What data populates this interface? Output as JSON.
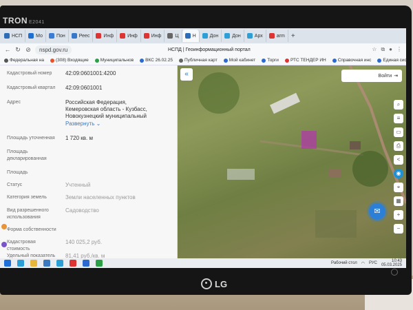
{
  "monitor": {
    "brand": "TRON",
    "model": "E2041",
    "logo": "LG"
  },
  "browser": {
    "tabs": [
      {
        "label": "НСП",
        "color": "#2d6db8"
      },
      {
        "label": "Мо",
        "color": "#1f6fd1"
      },
      {
        "label": "Пон",
        "color": "#3a7bd5"
      },
      {
        "label": "Реес",
        "color": "#3577c9"
      },
      {
        "label": "Инф",
        "color": "#d33"
      },
      {
        "label": "Инф",
        "color": "#d33"
      },
      {
        "label": "Инф",
        "color": "#d33"
      },
      {
        "label": "Ц",
        "color": "#666"
      },
      {
        "label": "Н",
        "color": "#2d6db8"
      },
      {
        "label": "Дон",
        "color": "#2b9fd6"
      },
      {
        "label": "Дон",
        "color": "#2b9fd6"
      },
      {
        "label": "Арх",
        "color": "#2b9fd6"
      },
      {
        "label": "arm",
        "color": "#d33"
      }
    ],
    "new_tab": "+",
    "url": "nspd.gov.ru",
    "page_title": "НСПД | Геоинформационный портал",
    "bookmarks": [
      {
        "label": "Федеральная на",
        "color": "#555"
      },
      {
        "label": "(308) Входящие",
        "color": "#e6522c"
      },
      {
        "label": "Муниципальнов",
        "color": "#2b9f45"
      },
      {
        "label": "ВКС 26.02.25",
        "color": "#2b6bd1"
      },
      {
        "label": "Публичная карт",
        "color": "#666"
      },
      {
        "label": "Мой кабинет",
        "color": "#2b6bd1"
      },
      {
        "label": "Торги",
        "color": "#2b6bd1"
      },
      {
        "label": "РТС ТЕНДЕР ИН",
        "color": "#d33"
      },
      {
        "label": "Справочная инс",
        "color": "#2b6bd1"
      },
      {
        "label": "Единая сист",
        "color": "#2b6bd1"
      }
    ]
  },
  "panel": {
    "rows": [
      {
        "label": "Кадастровый номер",
        "value": "42:09:0601001:4200"
      },
      {
        "label": "Кадастровый квартал",
        "value": "42:09:0601001"
      }
    ],
    "address": {
      "label": "Адрес",
      "lines": [
        "Российская Федерация,",
        "Кемеровская область - Кузбасс,",
        "Новокузнецкий муниципальный"
      ],
      "expand": "Развернуть"
    },
    "area": {
      "label": "Площадь уточненная",
      "value": "1 720 кв. м"
    },
    "area_declared": {
      "label1": "Площадь",
      "label2": "декларированная"
    },
    "area_plain": {
      "label": "Площадь"
    },
    "status": {
      "label": "Статус",
      "value": "Учтенный"
    },
    "category": {
      "label": "Категория земель",
      "value": "Земли населенных пунктов"
    },
    "permitted_use": {
      "label1": "Вид разрешенного",
      "label2": "использования",
      "value": "Садоводство"
    },
    "ownership": {
      "label": "Форма собственности"
    },
    "cadastral_cost": {
      "label1": "Кадастровая",
      "label2": "стоимость",
      "value": "140 025,2 руб."
    },
    "specific_index": {
      "label": "Удельный показатель",
      "value": "81,41 руб./кв. м"
    }
  },
  "map": {
    "collapse_icon": "«",
    "login_label": "Войти",
    "chat_icon": "chat-icon"
  },
  "taskbar": {
    "tray_text": "Рабочий стол",
    "lang": "РУС",
    "time": "10:43",
    "date": "05.03.2025"
  }
}
